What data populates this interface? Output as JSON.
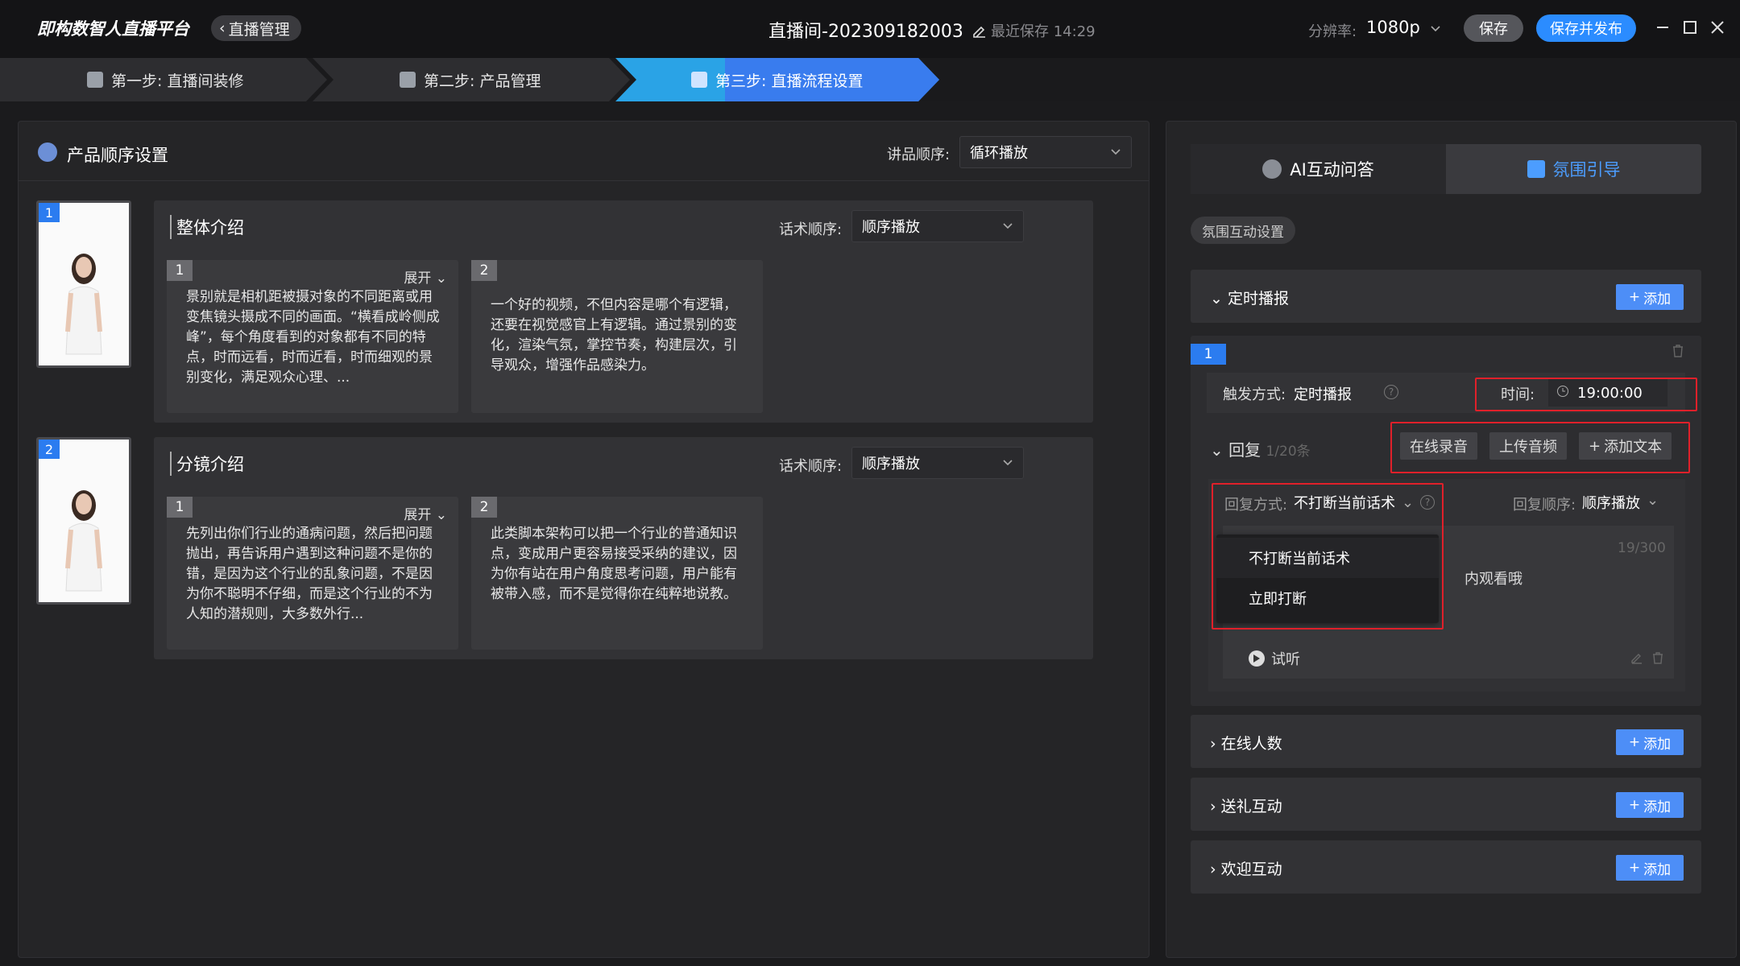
{
  "app": {
    "logo": "即构数智人直播平台",
    "back": "直播管理"
  },
  "header": {
    "room_title": "直播间-202309182003",
    "last_save": "最近保存 14:29",
    "resolution_label": "分辨率:",
    "resolution_value": "1080p",
    "save": "保存",
    "save_publish": "保存并发布"
  },
  "steps": [
    {
      "label": "第一步: 直播间装修"
    },
    {
      "label": "第二步: 产品管理"
    },
    {
      "label": "第三步: 直播流程设置"
    }
  ],
  "left": {
    "title": "产品顺序设置",
    "order_label": "讲品顺序:",
    "order_value": "循环播放",
    "products": [
      {
        "num": "1",
        "title": "整体介绍",
        "script_order_label": "话术顺序:",
        "script_order_value": "顺序播放",
        "scripts": [
          {
            "num": "1",
            "expand": "展开",
            "text": "景别就是相机距被摄对象的不同距离或用变焦镜头摄成不同的画面。“横看成岭侧成峰”，每个角度看到的对象都有不同的特点，时而远看，时而近看，时而细观的景别变化，满足观众心理、..."
          },
          {
            "num": "2",
            "text": "一个好的视频，不但内容是哪个有逻辑，还要在视觉感官上有逻辑。通过景别的变化，渲染气氛，掌控节奏，构建层次，引导观众，增强作品感染力。"
          }
        ]
      },
      {
        "num": "2",
        "title": "分镜介绍",
        "script_order_label": "话术顺序:",
        "script_order_value": "顺序播放",
        "scripts": [
          {
            "num": "1",
            "expand": "展开",
            "text": "先列出你们行业的通病问题，然后把问题抛出，再告诉用户遇到这种问题不是你的错，是因为这个行业的乱象问题，不是因为你不聪明不仔细，而是这个行业的不为人知的潜规则，大多数外行..."
          },
          {
            "num": "2",
            "text": "此类脚本架构可以把一个行业的普通知识点，变成用户更容易接受采纳的建议，因为你有站在用户角度思考问题，用户能有被带入感，而不是觉得你在纯粹地说教。"
          }
        ]
      }
    ]
  },
  "right": {
    "tab_ai": "AI互动问答",
    "tab_atmos": "氛围引导",
    "tag": "氛围互动设置",
    "timed": {
      "title": "定时播报",
      "add": "添加"
    },
    "rule": {
      "num": "1",
      "trigger_label": "触发方式:",
      "trigger_value": "定时播报",
      "time_label": "时间:",
      "time_value": "19:00:00",
      "reply_label": "回复",
      "reply_count": "1/20条",
      "btn_record": "在线录音",
      "btn_upload": "上传音频",
      "btn_add_text": "添加文本",
      "reply_mode_label": "回复方式:",
      "reply_mode_value": "不打断当前话术",
      "reply_order_label": "回复顺序:",
      "reply_order_value": "顺序播放",
      "char_count": "19/300",
      "text_partial": "内观看哦",
      "listen": "试听"
    },
    "dropdown": [
      "不打断当前话术",
      "立即打断"
    ],
    "sections": [
      {
        "title": "在线人数",
        "add": "添加"
      },
      {
        "title": "送礼互动",
        "add": "添加"
      },
      {
        "title": "欢迎互动",
        "add": "添加"
      }
    ]
  }
}
